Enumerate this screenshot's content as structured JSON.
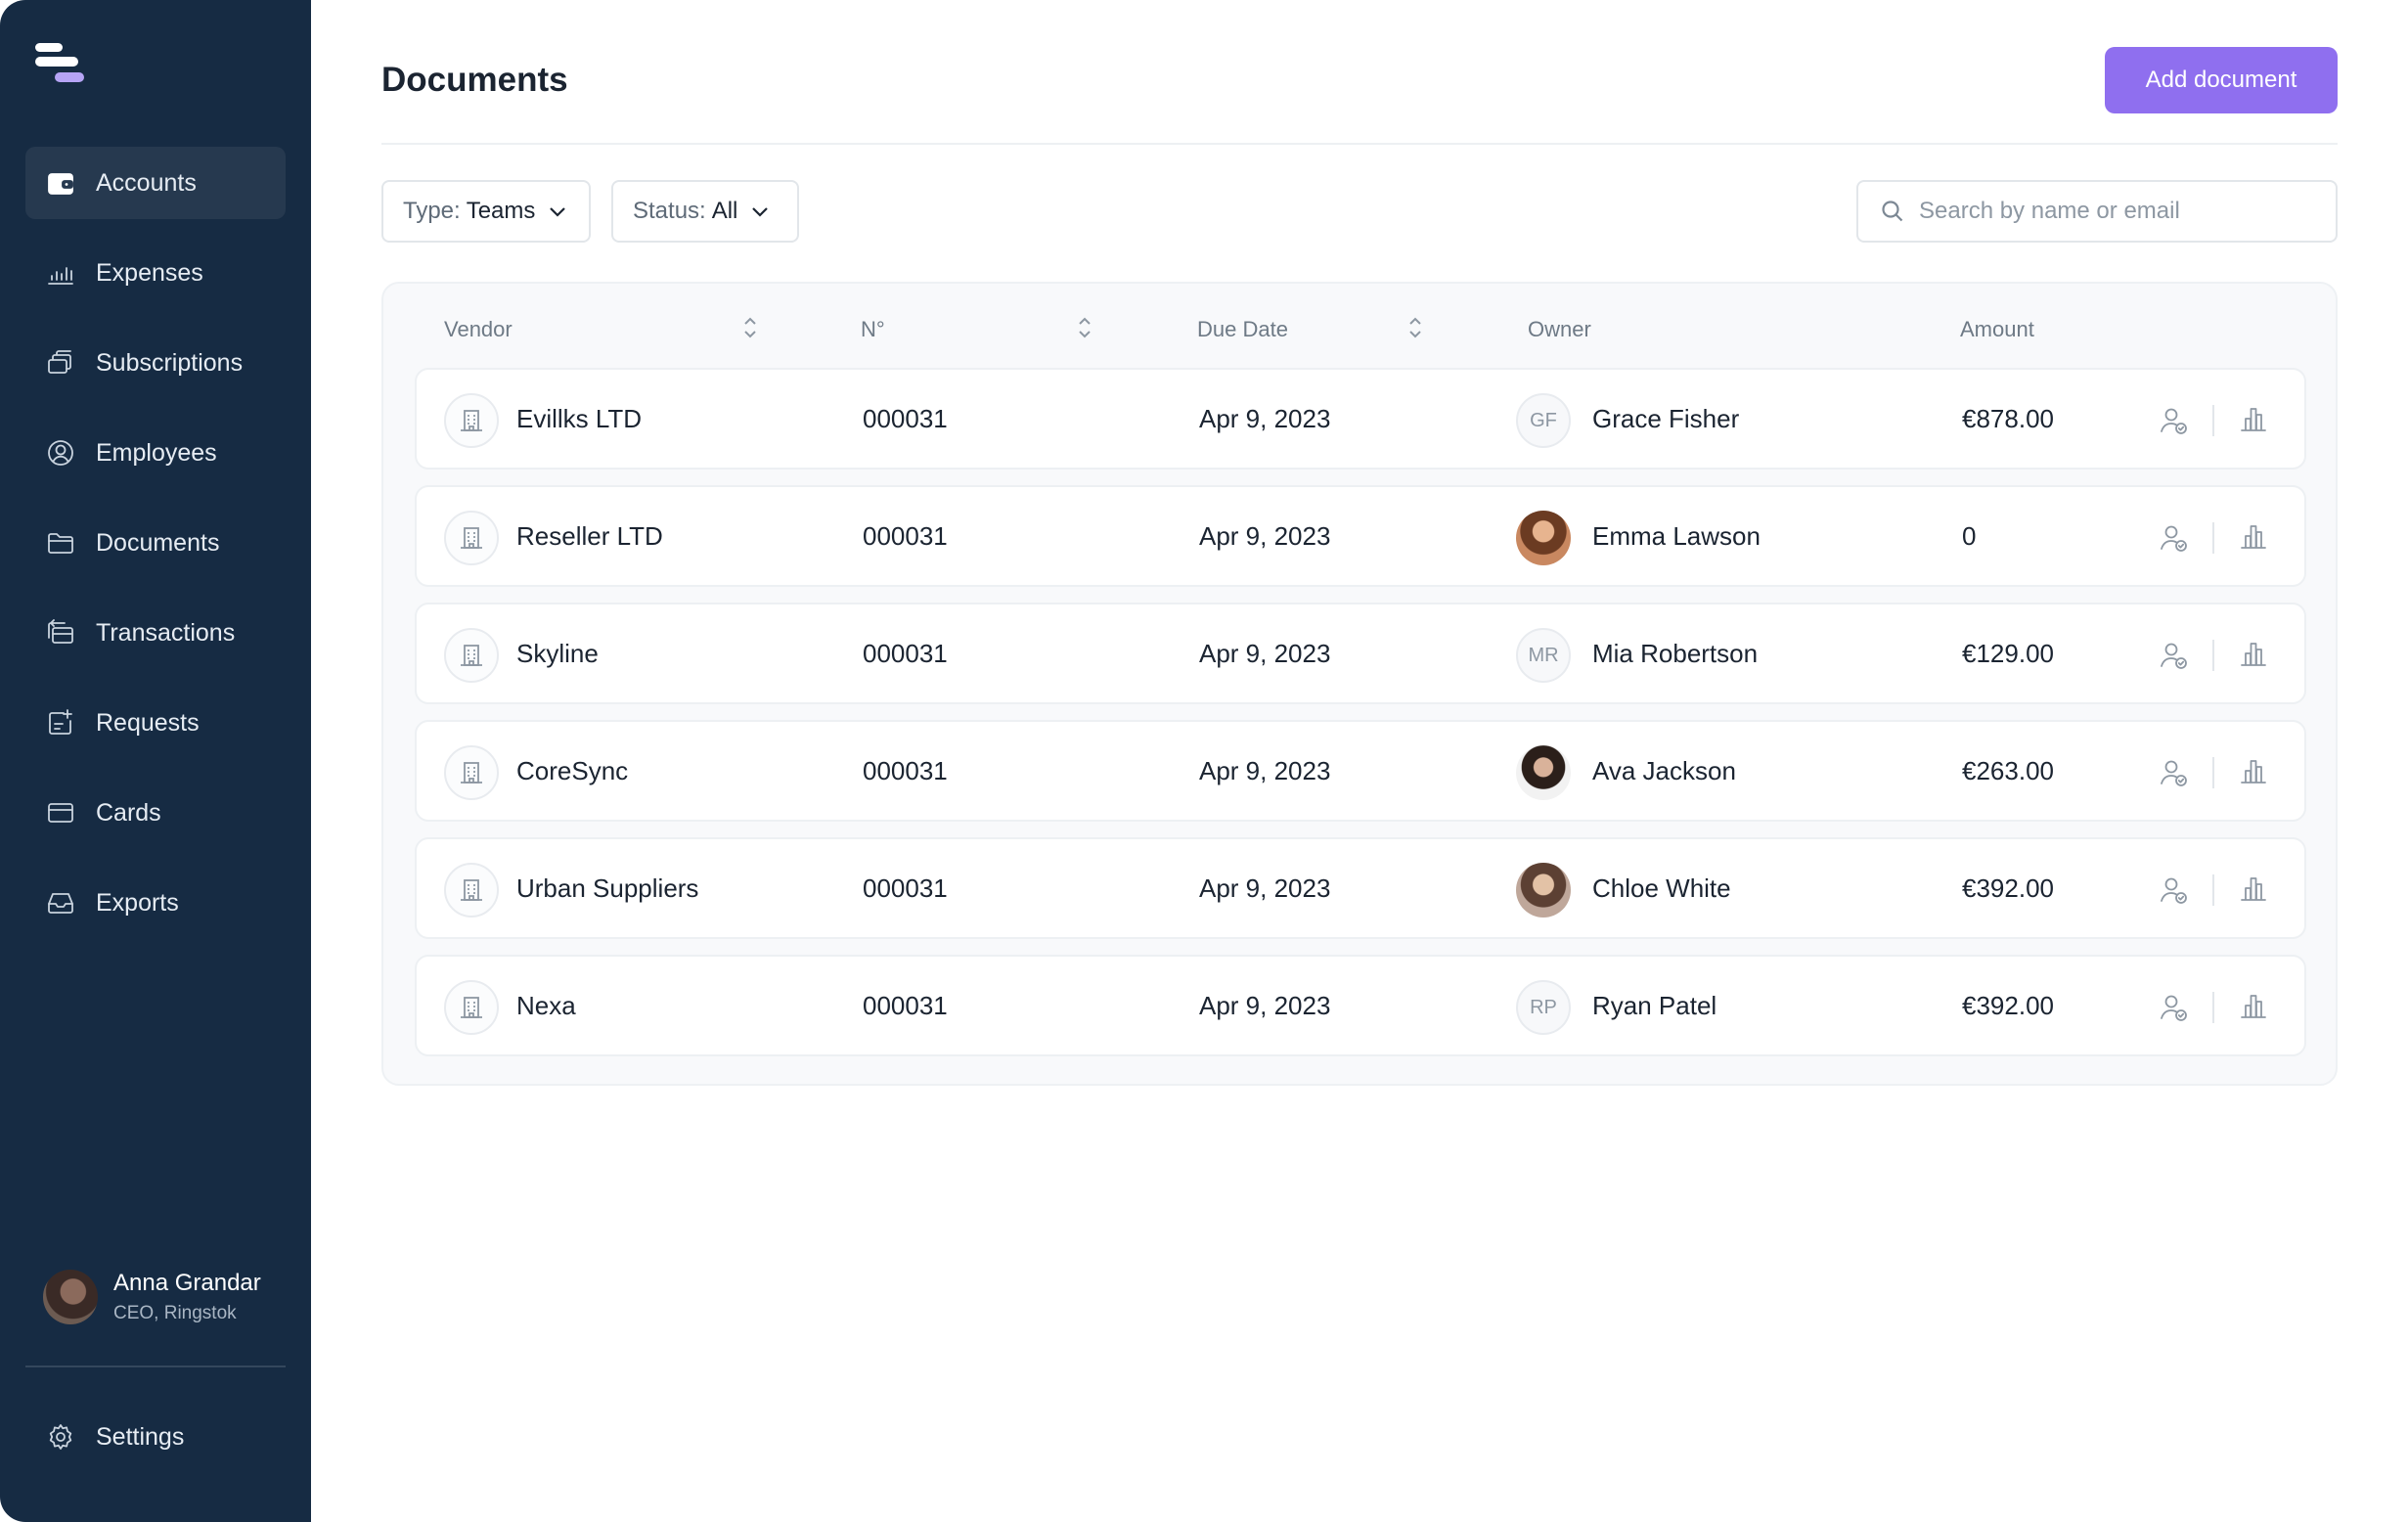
{
  "sidebar": {
    "items": [
      {
        "label": "Accounts",
        "icon": "wallet-icon",
        "active": true
      },
      {
        "label": "Expenses",
        "icon": "bar-chart-icon"
      },
      {
        "label": "Subscriptions",
        "icon": "stacked-cards-icon"
      },
      {
        "label": "Employees",
        "icon": "user-circle-icon"
      },
      {
        "label": "Documents",
        "icon": "folder-icon"
      },
      {
        "label": "Transactions",
        "icon": "transactions-icon"
      },
      {
        "label": "Requests",
        "icon": "request-add-icon"
      },
      {
        "label": "Cards",
        "icon": "credit-card-icon"
      },
      {
        "label": "Exports",
        "icon": "inbox-icon"
      }
    ],
    "profile": {
      "name": "Anna Grandar",
      "role": "CEO, Ringstok"
    },
    "settings_label": "Settings"
  },
  "header": {
    "title": "Documents",
    "add_button": "Add document"
  },
  "filters": {
    "type": {
      "label": "Type:",
      "value": "Teams"
    },
    "status": {
      "label": "Status:",
      "value": "All"
    },
    "search_placeholder": "Search by name or email"
  },
  "table": {
    "columns": {
      "vendor": "Vendor",
      "number": "N°",
      "due_date": "Due Date",
      "owner": "Owner",
      "amount": "Amount"
    },
    "rows": [
      {
        "vendor": "Evillks LTD",
        "number": "000031",
        "due_date": "Apr 9, 2023",
        "owner": "Grace Fisher",
        "initials": "GF",
        "photo": false,
        "amount": "€878.00"
      },
      {
        "vendor": "Reseller LTD",
        "number": "000031",
        "due_date": "Apr 9, 2023",
        "owner": "Emma Lawson",
        "initials": "",
        "photo": true,
        "amount": "0"
      },
      {
        "vendor": "Skyline",
        "number": "000031",
        "due_date": "Apr 9, 2023",
        "owner": "Mia Robertson",
        "initials": "MR",
        "photo": false,
        "amount": "€129.00"
      },
      {
        "vendor": "CoreSync",
        "number": "000031",
        "due_date": "Apr 9, 2023",
        "owner": "Ava Jackson",
        "initials": "",
        "photo": true,
        "amount": "€263.00"
      },
      {
        "vendor": "Urban Suppliers",
        "number": "000031",
        "due_date": "Apr 9, 2023",
        "owner": "Chloe White",
        "initials": "",
        "photo": true,
        "amount": "€392.00"
      },
      {
        "vendor": "Nexa",
        "number": "000031",
        "due_date": "Apr 9, 2023",
        "owner": "Ryan Patel",
        "initials": "RP",
        "photo": false,
        "amount": "€392.00"
      }
    ]
  },
  "colors": {
    "sidebar": "#162b43",
    "accent": "#8f6fef"
  }
}
